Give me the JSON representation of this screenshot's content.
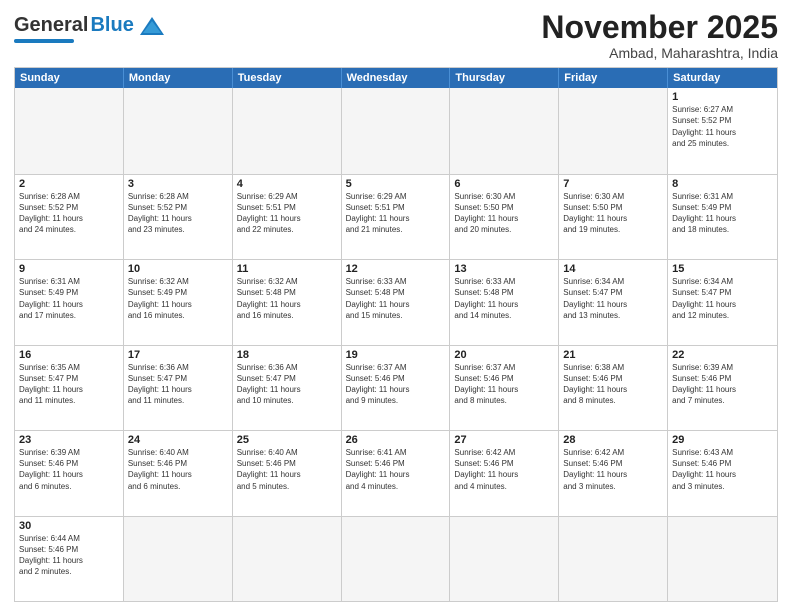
{
  "header": {
    "logo_general": "General",
    "logo_blue": "Blue",
    "month_title": "November 2025",
    "location": "Ambad, Maharashtra, India"
  },
  "weekdays": [
    "Sunday",
    "Monday",
    "Tuesday",
    "Wednesday",
    "Thursday",
    "Friday",
    "Saturday"
  ],
  "rows": [
    [
      {
        "num": "",
        "info": ""
      },
      {
        "num": "",
        "info": ""
      },
      {
        "num": "",
        "info": ""
      },
      {
        "num": "",
        "info": ""
      },
      {
        "num": "",
        "info": ""
      },
      {
        "num": "",
        "info": ""
      },
      {
        "num": "1",
        "info": "Sunrise: 6:27 AM\nSunset: 5:52 PM\nDaylight: 11 hours\nand 25 minutes."
      }
    ],
    [
      {
        "num": "2",
        "info": "Sunrise: 6:28 AM\nSunset: 5:52 PM\nDaylight: 11 hours\nand 24 minutes."
      },
      {
        "num": "3",
        "info": "Sunrise: 6:28 AM\nSunset: 5:52 PM\nDaylight: 11 hours\nand 23 minutes."
      },
      {
        "num": "4",
        "info": "Sunrise: 6:29 AM\nSunset: 5:51 PM\nDaylight: 11 hours\nand 22 minutes."
      },
      {
        "num": "5",
        "info": "Sunrise: 6:29 AM\nSunset: 5:51 PM\nDaylight: 11 hours\nand 21 minutes."
      },
      {
        "num": "6",
        "info": "Sunrise: 6:30 AM\nSunset: 5:50 PM\nDaylight: 11 hours\nand 20 minutes."
      },
      {
        "num": "7",
        "info": "Sunrise: 6:30 AM\nSunset: 5:50 PM\nDaylight: 11 hours\nand 19 minutes."
      },
      {
        "num": "8",
        "info": "Sunrise: 6:31 AM\nSunset: 5:49 PM\nDaylight: 11 hours\nand 18 minutes."
      }
    ],
    [
      {
        "num": "9",
        "info": "Sunrise: 6:31 AM\nSunset: 5:49 PM\nDaylight: 11 hours\nand 17 minutes."
      },
      {
        "num": "10",
        "info": "Sunrise: 6:32 AM\nSunset: 5:49 PM\nDaylight: 11 hours\nand 16 minutes."
      },
      {
        "num": "11",
        "info": "Sunrise: 6:32 AM\nSunset: 5:48 PM\nDaylight: 11 hours\nand 16 minutes."
      },
      {
        "num": "12",
        "info": "Sunrise: 6:33 AM\nSunset: 5:48 PM\nDaylight: 11 hours\nand 15 minutes."
      },
      {
        "num": "13",
        "info": "Sunrise: 6:33 AM\nSunset: 5:48 PM\nDaylight: 11 hours\nand 14 minutes."
      },
      {
        "num": "14",
        "info": "Sunrise: 6:34 AM\nSunset: 5:47 PM\nDaylight: 11 hours\nand 13 minutes."
      },
      {
        "num": "15",
        "info": "Sunrise: 6:34 AM\nSunset: 5:47 PM\nDaylight: 11 hours\nand 12 minutes."
      }
    ],
    [
      {
        "num": "16",
        "info": "Sunrise: 6:35 AM\nSunset: 5:47 PM\nDaylight: 11 hours\nand 11 minutes."
      },
      {
        "num": "17",
        "info": "Sunrise: 6:36 AM\nSunset: 5:47 PM\nDaylight: 11 hours\nand 11 minutes."
      },
      {
        "num": "18",
        "info": "Sunrise: 6:36 AM\nSunset: 5:47 PM\nDaylight: 11 hours\nand 10 minutes."
      },
      {
        "num": "19",
        "info": "Sunrise: 6:37 AM\nSunset: 5:46 PM\nDaylight: 11 hours\nand 9 minutes."
      },
      {
        "num": "20",
        "info": "Sunrise: 6:37 AM\nSunset: 5:46 PM\nDaylight: 11 hours\nand 8 minutes."
      },
      {
        "num": "21",
        "info": "Sunrise: 6:38 AM\nSunset: 5:46 PM\nDaylight: 11 hours\nand 8 minutes."
      },
      {
        "num": "22",
        "info": "Sunrise: 6:39 AM\nSunset: 5:46 PM\nDaylight: 11 hours\nand 7 minutes."
      }
    ],
    [
      {
        "num": "23",
        "info": "Sunrise: 6:39 AM\nSunset: 5:46 PM\nDaylight: 11 hours\nand 6 minutes."
      },
      {
        "num": "24",
        "info": "Sunrise: 6:40 AM\nSunset: 5:46 PM\nDaylight: 11 hours\nand 6 minutes."
      },
      {
        "num": "25",
        "info": "Sunrise: 6:40 AM\nSunset: 5:46 PM\nDaylight: 11 hours\nand 5 minutes."
      },
      {
        "num": "26",
        "info": "Sunrise: 6:41 AM\nSunset: 5:46 PM\nDaylight: 11 hours\nand 4 minutes."
      },
      {
        "num": "27",
        "info": "Sunrise: 6:42 AM\nSunset: 5:46 PM\nDaylight: 11 hours\nand 4 minutes."
      },
      {
        "num": "28",
        "info": "Sunrise: 6:42 AM\nSunset: 5:46 PM\nDaylight: 11 hours\nand 3 minutes."
      },
      {
        "num": "29",
        "info": "Sunrise: 6:43 AM\nSunset: 5:46 PM\nDaylight: 11 hours\nand 3 minutes."
      }
    ],
    [
      {
        "num": "30",
        "info": "Sunrise: 6:44 AM\nSunset: 5:46 PM\nDaylight: 11 hours\nand 2 minutes."
      },
      {
        "num": "",
        "info": ""
      },
      {
        "num": "",
        "info": ""
      },
      {
        "num": "",
        "info": ""
      },
      {
        "num": "",
        "info": ""
      },
      {
        "num": "",
        "info": ""
      },
      {
        "num": "",
        "info": ""
      }
    ]
  ]
}
